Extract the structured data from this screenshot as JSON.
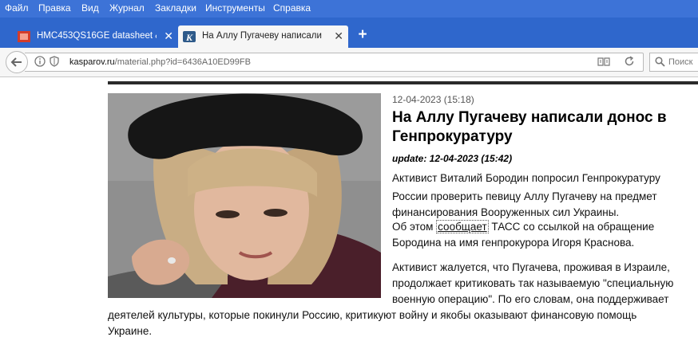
{
  "menu": [
    "Файл",
    "Правка",
    "Вид",
    "Журнал",
    "Закладки",
    "Инструменты",
    "Справка"
  ],
  "tabs": [
    {
      "title": "HMC453QS16GE datasheet &..."
    },
    {
      "title": "На Аллу Пугачеву написали..."
    }
  ],
  "address": {
    "host": "kasparov.ru",
    "path": "/material.php?id=6436A10ED99FB"
  },
  "search": {
    "placeholder": "Поиск"
  },
  "colors": {
    "menu_bg": "#3d73d7",
    "tab_bg": "#2f67cc",
    "toolbar_bg": "#f6f6f6"
  },
  "icons": [
    "back-arrow-icon",
    "info-icon",
    "shield-icon",
    "reader-view-icon",
    "reload-icon",
    "search-icon",
    "new-tab-icon",
    "close-icon"
  ],
  "article": {
    "date": "12-04-2023 (15:18)",
    "title": "На Аллу Пугачеву написали донос в Генпрокуратуру",
    "update": "update: 12-04-2023 (15:42)",
    "p1": [
      "Активист Виталий Бородин попросил Генпрокуратуру",
      "России проверить певицу Аллу Пугачеву на предмет",
      "финансирования Вооруженных сил Украины."
    ],
    "p1b_pre": "Об этом ",
    "p1b_link": "сообщает",
    "p1b_post": " ТАСС со ссылкой на обращение",
    "p1c": "Бородина на имя генпрокурора Игоря Краснова.",
    "p2": [
      "Активист жалуется, что Пугачева, проживая в Израиле,",
      "продолжает критиковать так называемую \"специальную",
      "военную операцию\". По его словам, она поддерживает",
      "деятелей культуры, которые покинули Россию, критикуют войну и якобы оказывают финансовую помощь",
      "Украине."
    ]
  }
}
